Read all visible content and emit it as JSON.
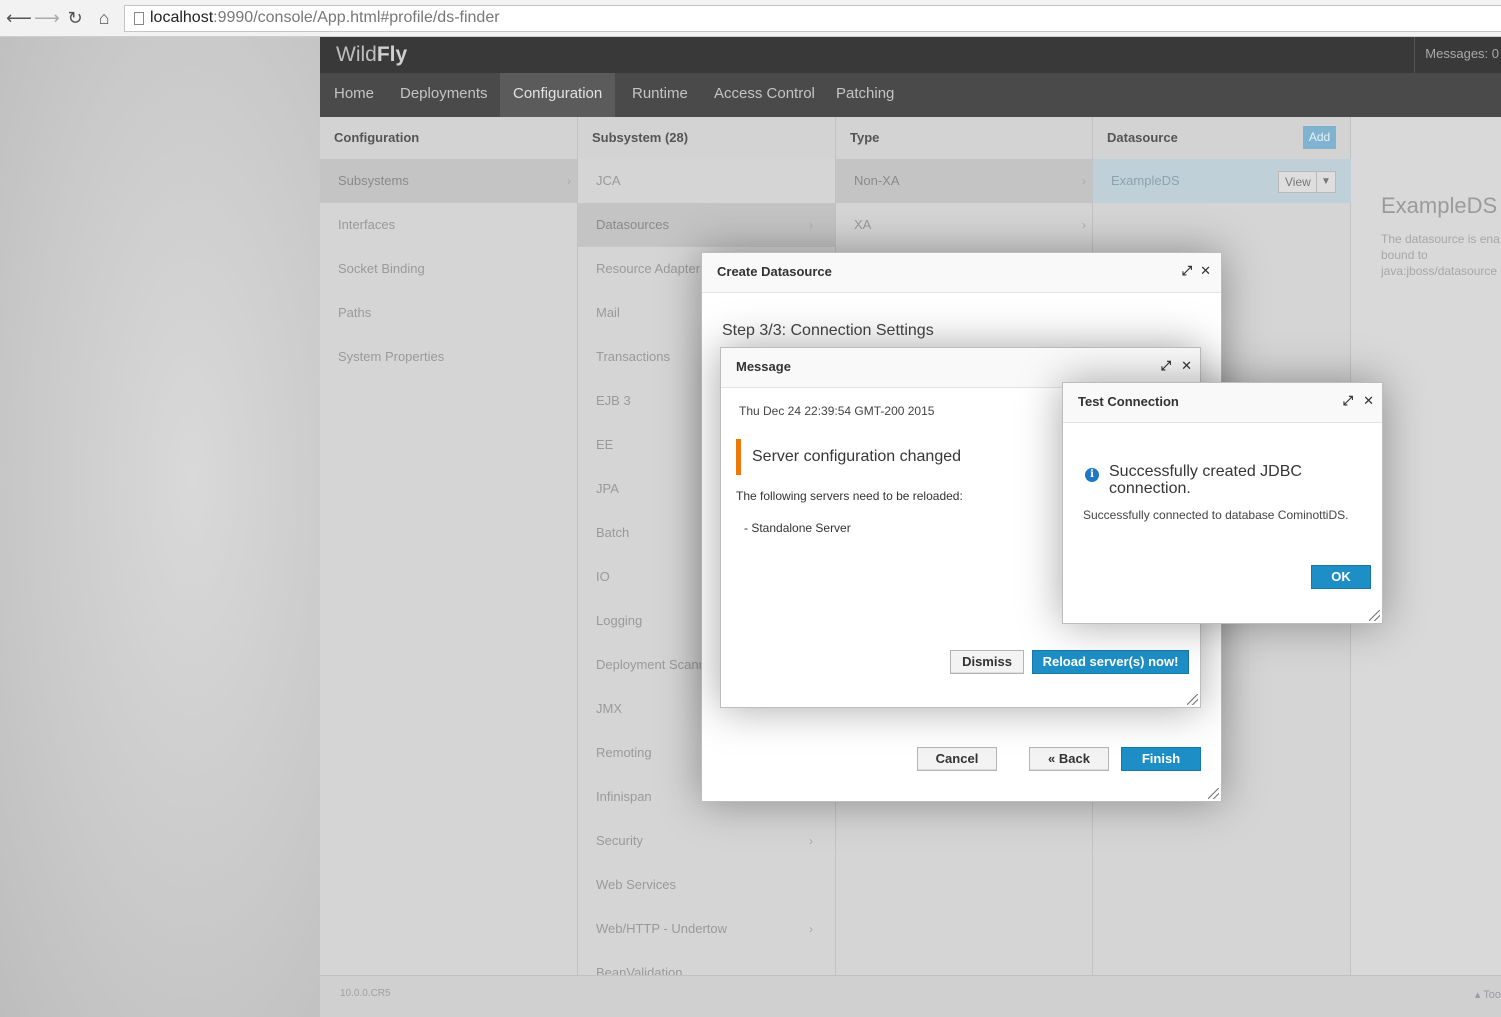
{
  "browser": {
    "url_host": "localhost",
    "url_rest": ":9990/console/App.html#profile/ds-finder"
  },
  "header": {
    "brand_light": "Wild",
    "brand_bold": "Fly",
    "messages": "Messages: 0"
  },
  "topnav": {
    "items": [
      "Home",
      "Deployments",
      "Configuration",
      "Runtime",
      "Access Control",
      "Patching"
    ],
    "active": "Configuration"
  },
  "columns": {
    "configuration": {
      "header": "Configuration",
      "items": [
        "Subsystems",
        "Interfaces",
        "Socket Binding",
        "Paths",
        "System Properties"
      ]
    },
    "subsystem": {
      "header": "Subsystem (28)",
      "items": [
        "JCA",
        "Datasources",
        "Resource Adapters",
        "Mail",
        "Transactions",
        "EJB 3",
        "EE",
        "JPA",
        "Batch",
        "IO",
        "Logging",
        "Deployment Scanners",
        "JMX",
        "Remoting",
        "Infinispan",
        "Security",
        "Web Services",
        "Web/HTTP - Undertow",
        "BeanValidation"
      ]
    },
    "type": {
      "header": "Type",
      "items": [
        "Non-XA",
        "XA"
      ]
    },
    "datasource": {
      "header": "Datasource",
      "add_label": "Add",
      "selected": "ExampleDS",
      "view_label": "View"
    }
  },
  "detail": {
    "title": "ExampleDS",
    "desc_line1": "The datasource is ena",
    "desc_line2": "bound to",
    "desc_line3": "java:jboss/datasource"
  },
  "footer": {
    "version": "10.0.0.CR5",
    "tools": "▴ Too"
  },
  "create_datasource": {
    "title": "Create Datasource",
    "step": "Step 3/3: Connection Settings",
    "cancel": "Cancel",
    "back": "« Back",
    "finish": "Finish"
  },
  "message": {
    "title": "Message",
    "date": "Thu Dec 24 22:39:54 GMT-200 2015",
    "alert": "Server configuration changed",
    "line1": "The following servers need to be reloaded:",
    "line2": "- Standalone Server",
    "dismiss": "Dismiss",
    "reload": "Reload server(s) now!"
  },
  "test_connection": {
    "title": "Test Connection",
    "heading": "Successfully created JDBC connection.",
    "detail": "Successfully connected to database CominottiDS.",
    "ok": "OK"
  },
  "icons": {
    "maximize": "⤢",
    "close": "✕",
    "info": "i"
  },
  "colors": {
    "primary": "#1e8fc6",
    "warning_bar": "#ec7a08",
    "info": "#1f78c1"
  }
}
